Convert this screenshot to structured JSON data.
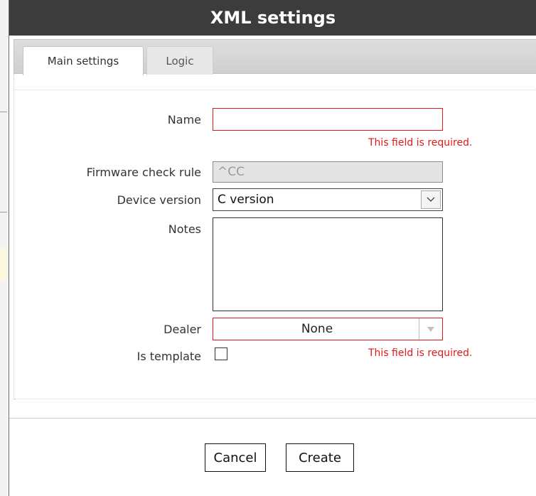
{
  "dialog": {
    "title": "XML settings"
  },
  "tabs": [
    {
      "label": "Main settings",
      "active": true
    },
    {
      "label": "Logic",
      "active": false
    }
  ],
  "form": {
    "name": {
      "label": "Name",
      "value": "",
      "error": "This field is required."
    },
    "firmware_check_rule": {
      "label": "Firmware check rule",
      "value": "^CC",
      "disabled": true
    },
    "device_version": {
      "label": "Device version",
      "selected": "C version"
    },
    "notes": {
      "label": "Notes",
      "value": ""
    },
    "dealer": {
      "label": "Dealer",
      "selected": "None",
      "error": "This field is required."
    },
    "is_template": {
      "label": "Is template",
      "checked": false
    }
  },
  "buttons": {
    "cancel": "Cancel",
    "create": "Create"
  },
  "colors": {
    "title_bar": "#3c3c3c",
    "error": "#e21a1a"
  },
  "icons": {
    "select_arrow": "chevron-down-icon",
    "dealer_arrow": "triangle-down-icon"
  }
}
